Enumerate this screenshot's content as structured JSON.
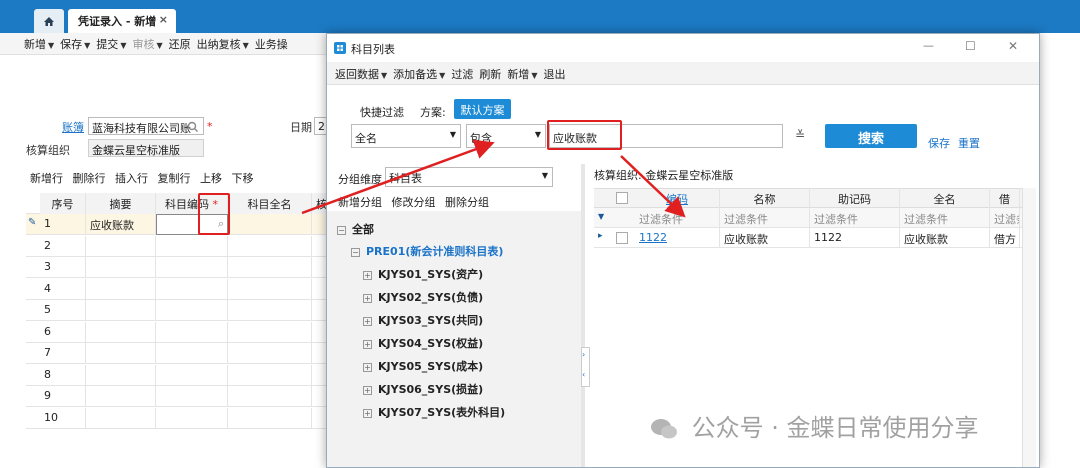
{
  "tabs": {
    "document_tab": "凭证录入 - 新增",
    "close_glyph": "×"
  },
  "main_toolbar": [
    {
      "label": "新增",
      "caret": true
    },
    {
      "label": "保存",
      "caret": true
    },
    {
      "label": "提交",
      "caret": true
    },
    {
      "label": "审核",
      "caret": true,
      "disabled": true
    },
    {
      "label": "还原",
      "caret": false
    },
    {
      "label": "出纳复核",
      "caret": true
    },
    {
      "label": "业务操",
      "caret": false
    }
  ],
  "form": {
    "account_book_label": "账簿",
    "account_book_value": "蓝海科技有限公司账",
    "required_mark": "*",
    "date_label": "日期",
    "date_value": "2",
    "org_label": "核算组织",
    "org_value": "金蝶云星空标准版"
  },
  "grid_toolbar": [
    "新增行",
    "删除行",
    "插入行",
    "复制行",
    "上移",
    "下移"
  ],
  "grid": {
    "columns": [
      "序号",
      "摘要",
      "科目编码",
      "科目全名",
      "核"
    ],
    "rows": [
      {
        "n": "1",
        "summary": "应收账款"
      },
      {
        "n": "2",
        "summary": ""
      },
      {
        "n": "3",
        "summary": ""
      },
      {
        "n": "4",
        "summary": ""
      },
      {
        "n": "5",
        "summary": ""
      },
      {
        "n": "6",
        "summary": ""
      },
      {
        "n": "7",
        "summary": ""
      },
      {
        "n": "8",
        "summary": ""
      },
      {
        "n": "9",
        "summary": ""
      },
      {
        "n": "10",
        "summary": ""
      }
    ]
  },
  "dialog": {
    "title": "科目列表",
    "window_controls": [
      "—",
      "☐",
      "✕"
    ],
    "toolbar": [
      {
        "label": "返回数据",
        "caret": true
      },
      {
        "label": "添加备选",
        "caret": true
      },
      {
        "label": "过滤",
        "caret": false
      },
      {
        "label": "刷新",
        "caret": false
      },
      {
        "label": "新增",
        "caret": true
      },
      {
        "label": "退出",
        "caret": false
      }
    ],
    "quick_filter_label": "快捷过滤",
    "scheme_label": "方案:",
    "scheme_default": "默认方案",
    "filter_field": "全名",
    "filter_operator": "包含",
    "filter_value": "应收账款",
    "search_button": "搜索",
    "save_link": "保存",
    "reset_link": "重置",
    "group_dim_label": "分组维度",
    "group_dim_value": "科目表",
    "group_actions": [
      "新增分组",
      "修改分组",
      "删除分组"
    ],
    "tree": {
      "root": "全部",
      "chart": "PRE01(新会计准则科目表)",
      "children": [
        "KJYS01_SYS(资产)",
        "KJYS02_SYS(负债)",
        "KJYS03_SYS(共同)",
        "KJYS04_SYS(权益)",
        "KJYS05_SYS(成本)",
        "KJYS06_SYS(损益)",
        "KJYS07_SYS(表外科目)"
      ]
    },
    "org_caption": "核算组织: 金蝶云星空标准版",
    "result_columns": [
      "编码",
      "名称",
      "助记码",
      "全名",
      "借"
    ],
    "filter_placeholder": "过滤条件",
    "result_rows": [
      {
        "code": "1122",
        "name": "应收账款",
        "mnemonic": "1122",
        "fullname": "应收账款",
        "direction": "借方"
      }
    ]
  },
  "watermark": "公众号 · 金蝶日常使用分享",
  "colors": {
    "brand_blue": "#1c7ac4",
    "highlight_red": "#e02020",
    "link_blue": "#1a73c8"
  }
}
